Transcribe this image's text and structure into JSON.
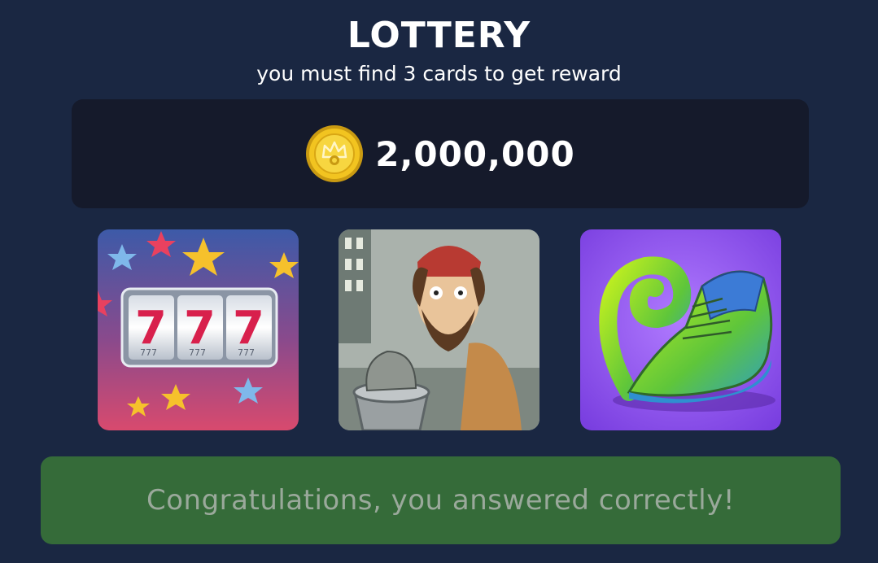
{
  "header": {
    "title": "LOTTERY",
    "subtitle": "you must find 3 cards to get reward"
  },
  "reward": {
    "icon": "gold-coin-icon",
    "amount": "2,000,000"
  },
  "cards": [
    {
      "name": "slot-machine-777-card",
      "icon": "slot-machine-icon"
    },
    {
      "name": "homeless-man-trash-card",
      "icon": "homeless-man-icon"
    },
    {
      "name": "curled-green-shoe-card",
      "icon": "shoe-icon"
    }
  ],
  "result": {
    "message": "Congratulations, you answered correctly!"
  },
  "colors": {
    "background": "#1a2742",
    "panel": "#151a2b",
    "success": "#356b39",
    "success_text": "#9aa99b"
  }
}
